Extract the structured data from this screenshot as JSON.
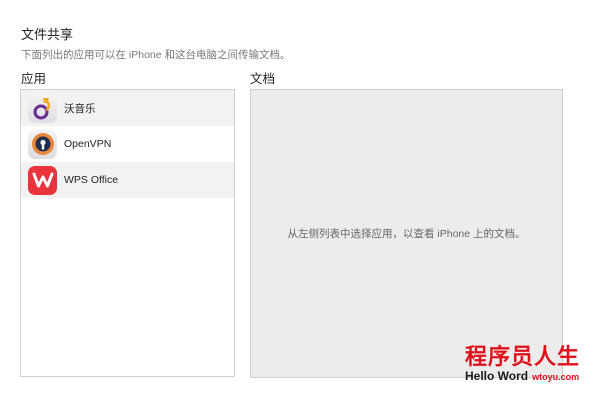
{
  "header": {
    "title": "文件共享",
    "subtitle": "下面列出的应用可以在 iPhone 和这台电脑之间传输文档。"
  },
  "apps_heading": "应用",
  "docs_heading": "文档",
  "apps": [
    {
      "label": "沃音乐",
      "icon": "wo-music-icon"
    },
    {
      "label": "OpenVPN",
      "icon": "openvpn-icon"
    },
    {
      "label": "WPS Office",
      "icon": "wps-office-icon"
    }
  ],
  "docs_message": "从左侧列表中选择应用，以查看 iPhone 上的文档。",
  "watermark": {
    "title": "程序员人生",
    "hello": "Hello Word",
    "site": "wtoyu.com"
  },
  "colors": {
    "wps_red": "#e8343a",
    "openvpn_orange": "#e8873a",
    "openvpn_navy": "#1f2f4f",
    "wm_red": "#e0101a"
  }
}
